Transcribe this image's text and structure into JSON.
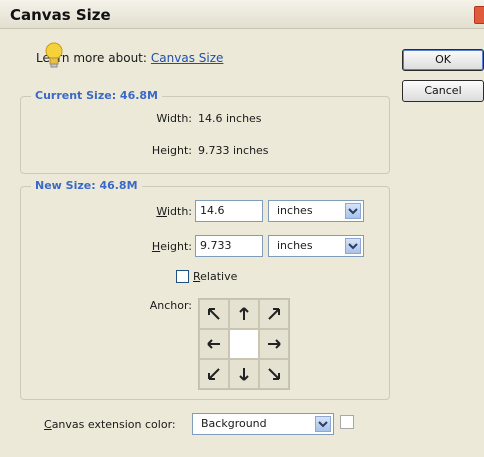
{
  "window": {
    "title": "Canvas Size",
    "close_icon": "close-icon"
  },
  "learn": {
    "prefix": "Learn more about:",
    "link": "Canvas Size"
  },
  "buttons": {
    "ok": "OK",
    "cancel": "Cancel"
  },
  "current_size": {
    "title": "Current Size: 46.8M",
    "width_label": "Width:",
    "width_value": "14.6 inches",
    "height_label": "Height:",
    "height_value": "9.733 inches"
  },
  "new_size": {
    "title": "New Size: 46.8M",
    "width_label_mnemonic": "W",
    "width_label_rest": "idth:",
    "width_value": "14.6",
    "width_unit": "inches",
    "height_label_mnemonic": "H",
    "height_label_rest": "eight:",
    "height_value": "9.733",
    "height_unit": "inches",
    "relative_mnemonic": "R",
    "relative_rest": "elative",
    "relative_checked": false,
    "anchor_label": "Anchor:"
  },
  "extension": {
    "label_mnemonic": "C",
    "label_rest": "anvas extension color:",
    "value": "Background",
    "swatch_color": "#ffffff"
  }
}
